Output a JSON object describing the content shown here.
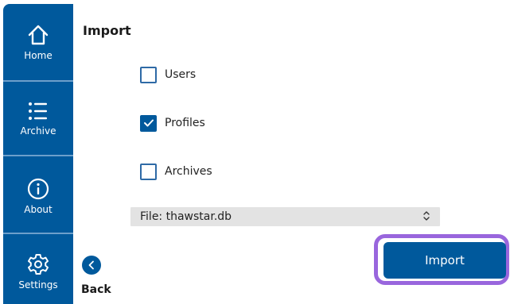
{
  "sidebar": {
    "items": [
      {
        "label": "Home",
        "icon": "home-icon"
      },
      {
        "label": "Archive",
        "icon": "list-icon"
      },
      {
        "label": "About",
        "icon": "info-icon"
      },
      {
        "label": "Settings",
        "icon": "gear-icon"
      }
    ]
  },
  "page": {
    "title": "Import"
  },
  "options": [
    {
      "label": "Users",
      "checked": false
    },
    {
      "label": "Profiles",
      "checked": true
    },
    {
      "label": "Archives",
      "checked": false
    }
  ],
  "file_select": {
    "value": "File: thawstar.db",
    "icon": "up-down-chevron-icon"
  },
  "back": {
    "label": "Back",
    "icon": "chevron-left-icon"
  },
  "import_button": {
    "label": "Import"
  },
  "colors": {
    "brand": "#00599c",
    "highlight": "#9966dd",
    "select_bg": "#e3e3e3"
  }
}
